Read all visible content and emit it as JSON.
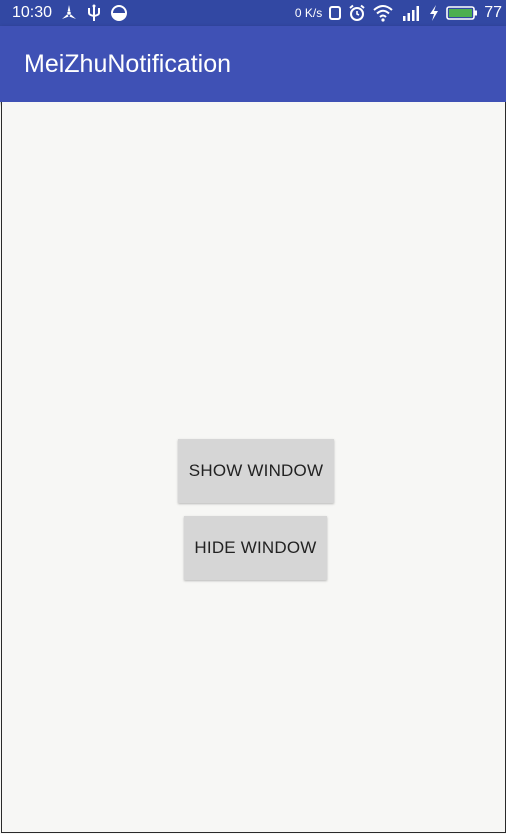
{
  "status_bar": {
    "time": "10:30",
    "left_icons": [
      "fan-icon",
      "usb-icon",
      "half-circle-icon"
    ],
    "data_rate": "0 K/s",
    "right_icons": [
      "screen-rotate-icon",
      "alarm-icon",
      "wifi-icon",
      "signal-icon",
      "charging-icon",
      "battery-icon"
    ],
    "battery_level": "77",
    "battery_color": "#4caf50",
    "background_color": "#3248a3"
  },
  "app_bar": {
    "title": "MeiZhuNotification",
    "background_color": "#3f51b5"
  },
  "main": {
    "show_button_label": "SHOW WINDOW",
    "hide_button_label": "HIDE WINDOW",
    "button_color": "#d6d6d6"
  }
}
